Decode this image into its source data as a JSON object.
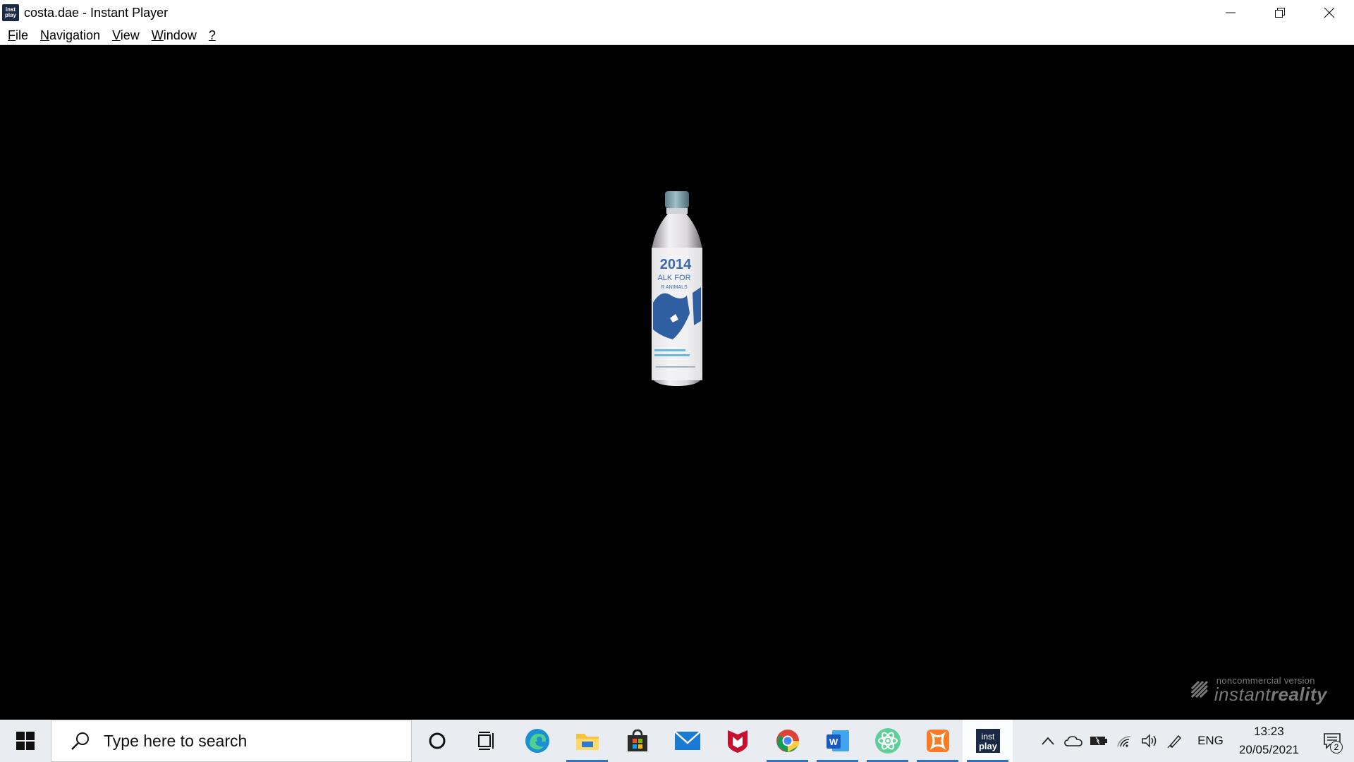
{
  "window": {
    "title": "costa.dae - Instant Player",
    "app_icon_text": [
      "inst",
      "play"
    ],
    "controls": [
      "minimize",
      "restore",
      "close"
    ]
  },
  "menu": {
    "items": [
      {
        "label": "File",
        "accel": "F"
      },
      {
        "label": "Navigation",
        "accel": "N"
      },
      {
        "label": "View",
        "accel": "V"
      },
      {
        "label": "Window",
        "accel": "W"
      },
      {
        "label": "?",
        "accel": "?"
      }
    ]
  },
  "viewport": {
    "background": "#000000",
    "model": {
      "label_year": "2014",
      "label_line1": "ALK FOR",
      "label_line2": "R ANIMALS"
    },
    "watermark": {
      "small": "noncommercial version",
      "big_regular": "instant",
      "big_bold": "reality"
    }
  },
  "taskbar": {
    "search_placeholder": "Type here to search",
    "pinned": [
      {
        "name": "cortana",
        "running": false
      },
      {
        "name": "task-view",
        "running": false
      },
      {
        "name": "edge",
        "running": false
      },
      {
        "name": "file-explorer",
        "running": true
      },
      {
        "name": "microsoft-store",
        "running": false
      },
      {
        "name": "mail",
        "running": false
      },
      {
        "name": "mcafee",
        "running": false
      },
      {
        "name": "chrome",
        "running": true
      },
      {
        "name": "word",
        "running": true
      },
      {
        "name": "atom",
        "running": true
      },
      {
        "name": "xampp",
        "running": true
      },
      {
        "name": "instant-player",
        "running": true,
        "active": true
      }
    ],
    "tray": {
      "language": "ENG",
      "time": "13:23",
      "date": "20/05/2021",
      "notification_count": "2"
    },
    "accent": "#2b73c9"
  }
}
